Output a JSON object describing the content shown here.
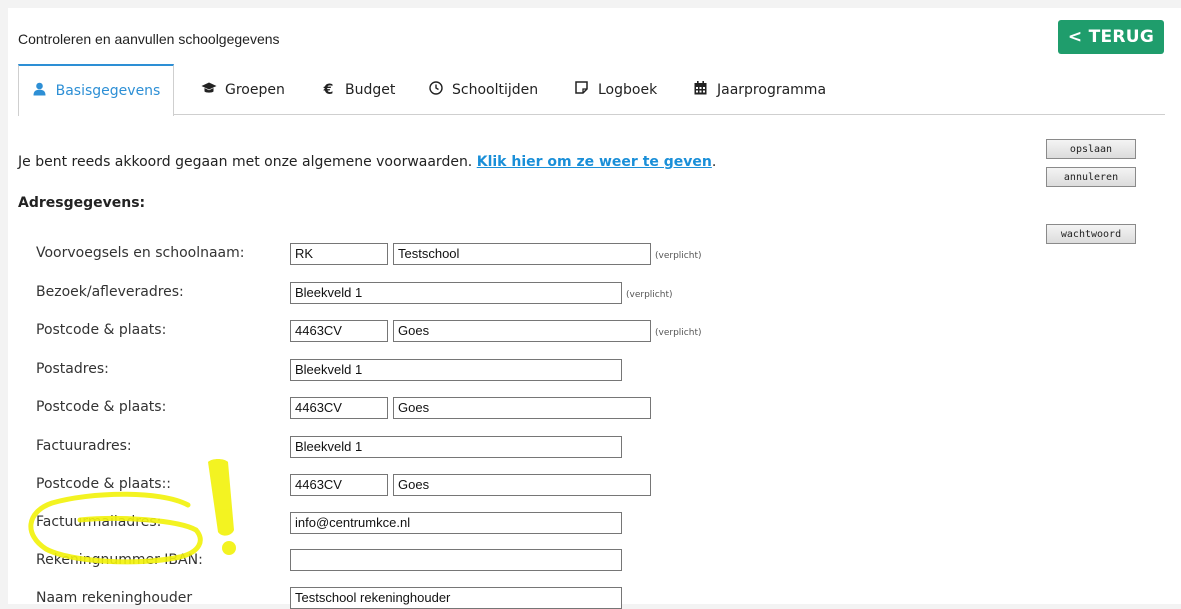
{
  "header": {
    "title": "Controleren en aanvullen schoolgegevens",
    "back_label": "< TERUG"
  },
  "tabs": [
    {
      "label": "Basisgegevens",
      "icon": "user-icon"
    },
    {
      "label": "Groepen",
      "icon": "graduation-cap-icon"
    },
    {
      "label": "Budget",
      "icon": "euro-icon"
    },
    {
      "label": "Schooltijden",
      "icon": "clock-icon"
    },
    {
      "label": "Logboek",
      "icon": "note-icon"
    },
    {
      "label": "Jaarprogramma",
      "icon": "calendar-icon"
    }
  ],
  "intro": {
    "text": "Je bent reeds akkoord gegaan met onze algemene voorwaarden. ",
    "link": "Klik hier om ze weer te geven",
    "suffix": "."
  },
  "section_title": "Adresgegevens:",
  "required_label": "(verplicht)",
  "side_buttons": {
    "save": "opslaan",
    "cancel": "annuleren",
    "password": "wachtwoord"
  },
  "form": {
    "school_name_label": "Voorvoegsels en schoolnaam:",
    "prefix": "RK",
    "school_name": "Testschool",
    "visit_address_label": "Bezoek/afleveradres:",
    "visit_address": "Bleekveld 1",
    "visit_postcode_label": "Postcode & plaats:",
    "visit_postcode": "4463CV",
    "visit_city": "Goes",
    "postal_address_label": "Postadres:",
    "postal_address": "Bleekveld 1",
    "postal_postcode_label": "Postcode & plaats:",
    "postal_postcode": "4463CV",
    "postal_city": "Goes",
    "invoice_address_label": "Factuuradres:",
    "invoice_address": "Bleekveld 1",
    "invoice_postcode_label": "Postcode & plaats::",
    "invoice_postcode": "4463CV",
    "invoice_city": "Goes",
    "invoice_email_label": "Factuurmailadres:",
    "invoice_email": "info@centrumkce.nl",
    "iban_label": "Rekeningnummer IBAN:",
    "iban": "",
    "account_holder_label": "Naam rekeninghouder",
    "account_holder": "Testschool rekeninghouder"
  },
  "colors": {
    "accent": "#2d8fd5",
    "back_button": "#1f9d6c",
    "highlight": "#f2f20a"
  }
}
